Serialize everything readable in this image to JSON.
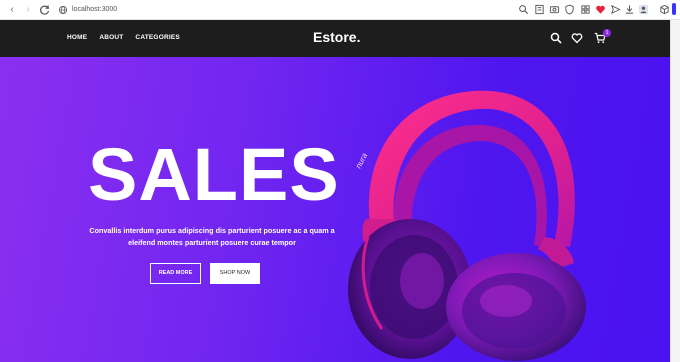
{
  "browser": {
    "url": "localhost:3000",
    "icons": [
      "back-icon",
      "forward-icon",
      "reload-icon",
      "globe-icon",
      "search-icon",
      "read-icon",
      "screenshot-icon",
      "shield-icon",
      "grid-icon",
      "send-icon",
      "heart-icon",
      "download-icon",
      "extensions-icon",
      "profile-icon",
      "tablet-icon"
    ]
  },
  "header": {
    "menu": [
      "HOME",
      "ABOUT",
      "CATEGORIES"
    ],
    "logo": "Estore.",
    "cart_count": "1"
  },
  "hero": {
    "title": "SALES",
    "subtitle": "Convallis interdum purus adipiscing dis parturient posuere ac a quam a eleifend montes parturient posuere curae tempor",
    "read_more": "READ MORE",
    "shop_now": "SHOP NOW",
    "product_brand": "nura"
  },
  "colors": {
    "hero_start": "#8b2ff0",
    "hero_end": "#4a12f0",
    "header_bg": "#1d1d1d",
    "badge": "#8a2be2"
  }
}
